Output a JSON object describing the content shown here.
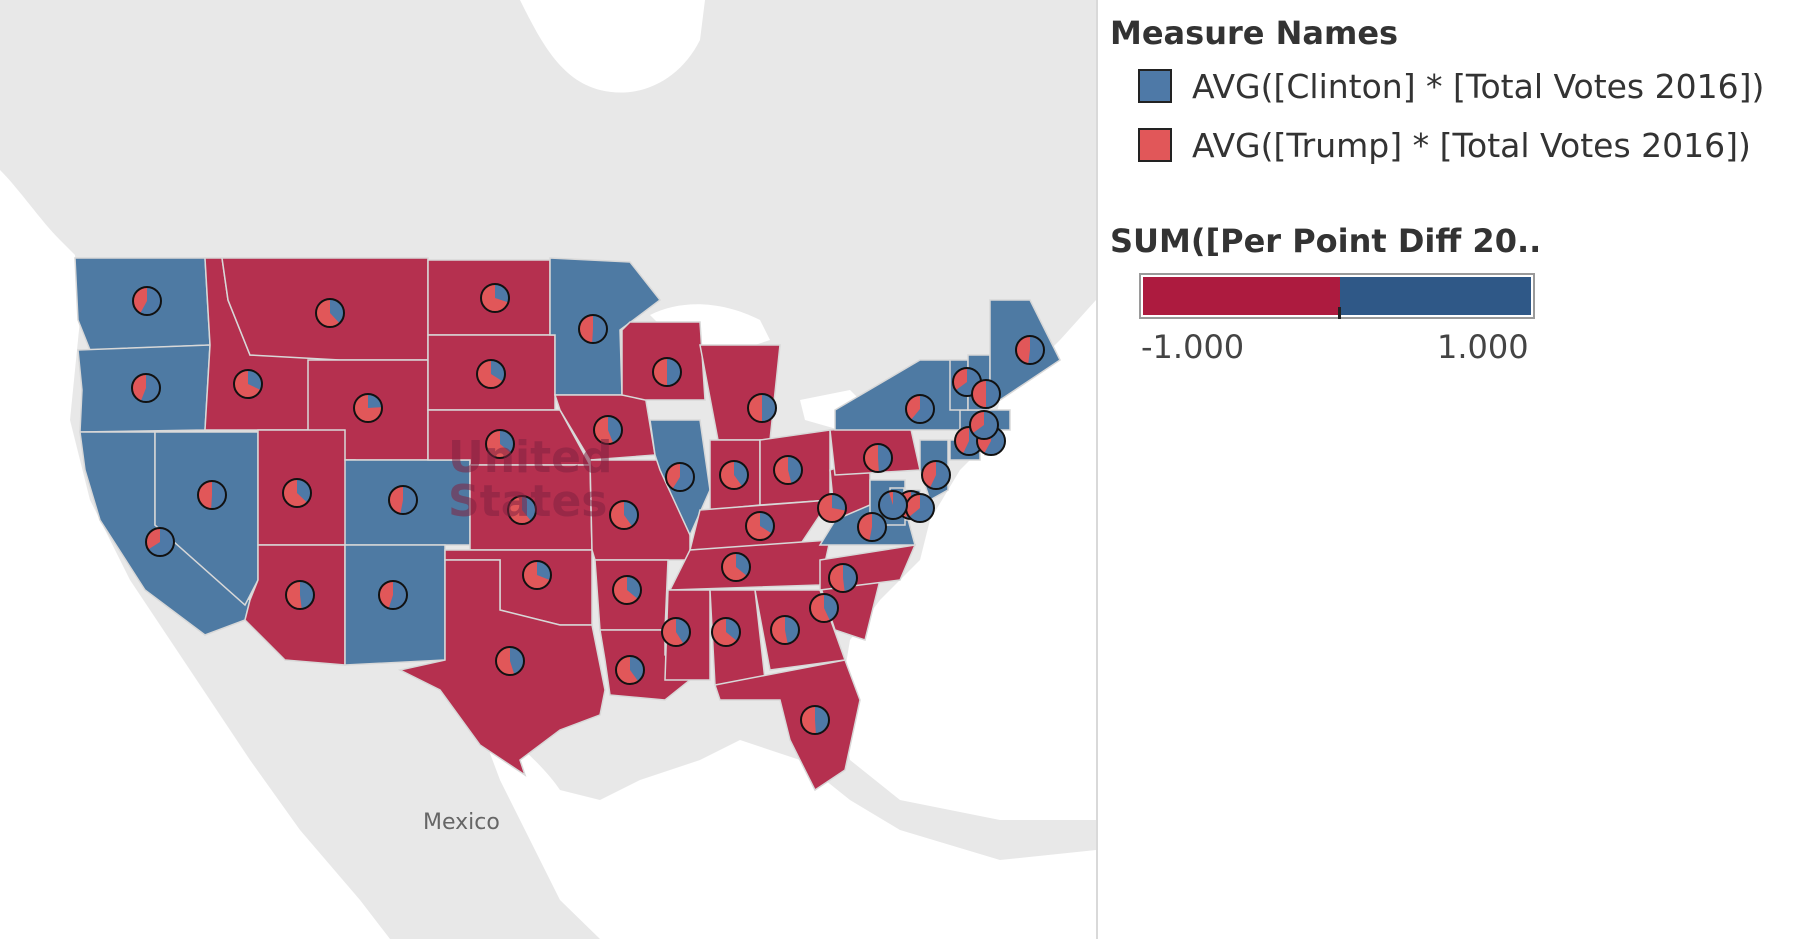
{
  "colors": {
    "clinton": "#4e79a7",
    "trump": "#e15759",
    "state_dem": "#4e7aa3",
    "state_rep": "#b5304f",
    "ramp_neg": "#ad1b3f",
    "ramp_pos": "#2f5887",
    "land": "#e8e8e8",
    "water": "#ffffff"
  },
  "map": {
    "country_label": "United States",
    "country_label_line1": "United",
    "country_label_line2": "States",
    "neighbor_label": "Mexico"
  },
  "legend": {
    "measure_title": "Measure Names",
    "items": [
      {
        "label": "AVG([Clinton] * [Total Votes 2016])",
        "color_key": "clinton"
      },
      {
        "label": "AVG([Trump] * [Total Votes 2016])",
        "color_key": "trump"
      }
    ],
    "color_title": "SUM([Per Point Diff 20..",
    "ramp_min": "-1.000",
    "ramp_max": "1.000"
  },
  "states": [
    {
      "code": "WA",
      "winner": "D",
      "clinton_share": 0.58
    },
    {
      "code": "OR",
      "winner": "D",
      "clinton_share": 0.56
    },
    {
      "code": "CA",
      "winner": "D",
      "clinton_share": 0.66
    },
    {
      "code": "NV",
      "winner": "D",
      "clinton_share": 0.51
    },
    {
      "code": "ID",
      "winner": "R",
      "clinton_share": 0.32
    },
    {
      "code": "MT",
      "winner": "R",
      "clinton_share": 0.38
    },
    {
      "code": "WY",
      "winner": "R",
      "clinton_share": 0.24
    },
    {
      "code": "UT",
      "winner": "R",
      "clinton_share": 0.37
    },
    {
      "code": "AZ",
      "winner": "R",
      "clinton_share": 0.48
    },
    {
      "code": "CO",
      "winner": "D",
      "clinton_share": 0.53
    },
    {
      "code": "NM",
      "winner": "D",
      "clinton_share": 0.55
    },
    {
      "code": "ND",
      "winner": "R",
      "clinton_share": 0.3
    },
    {
      "code": "SD",
      "winner": "R",
      "clinton_share": 0.34
    },
    {
      "code": "NE",
      "winner": "R",
      "clinton_share": 0.36
    },
    {
      "code": "KS",
      "winner": "R",
      "clinton_share": 0.39
    },
    {
      "code": "OK",
      "winner": "R",
      "clinton_share": 0.31
    },
    {
      "code": "TX",
      "winner": "R",
      "clinton_share": 0.45
    },
    {
      "code": "MN",
      "winner": "D",
      "clinton_share": 0.51
    },
    {
      "code": "IA",
      "winner": "R",
      "clinton_share": 0.44
    },
    {
      "code": "MO",
      "winner": "R",
      "clinton_share": 0.4
    },
    {
      "code": "AR",
      "winner": "R",
      "clinton_share": 0.36
    },
    {
      "code": "LA",
      "winner": "R",
      "clinton_share": 0.4
    },
    {
      "code": "WI",
      "winner": "R",
      "clinton_share": 0.5
    },
    {
      "code": "IL",
      "winner": "D",
      "clinton_share": 0.59
    },
    {
      "code": "MI",
      "winner": "R",
      "clinton_share": 0.5
    },
    {
      "code": "IN",
      "winner": "R",
      "clinton_share": 0.4
    },
    {
      "code": "OH",
      "winner": "R",
      "clinton_share": 0.46
    },
    {
      "code": "KY",
      "winner": "R",
      "clinton_share": 0.34
    },
    {
      "code": "TN",
      "winner": "R",
      "clinton_share": 0.36
    },
    {
      "code": "MS",
      "winner": "R",
      "clinton_share": 0.41
    },
    {
      "code": "AL",
      "winner": "R",
      "clinton_share": 0.36
    },
    {
      "code": "GA",
      "winner": "R",
      "clinton_share": 0.47
    },
    {
      "code": "FL",
      "winner": "R",
      "clinton_share": 0.49
    },
    {
      "code": "SC",
      "winner": "R",
      "clinton_share": 0.43
    },
    {
      "code": "NC",
      "winner": "R",
      "clinton_share": 0.48
    },
    {
      "code": "VA",
      "winner": "D",
      "clinton_share": 0.53
    },
    {
      "code": "WV",
      "winner": "R",
      "clinton_share": 0.28
    },
    {
      "code": "PA",
      "winner": "R",
      "clinton_share": 0.49
    },
    {
      "code": "NY",
      "winner": "D",
      "clinton_share": 0.61
    },
    {
      "code": "NJ",
      "winner": "D",
      "clinton_share": 0.57
    },
    {
      "code": "DE",
      "winner": "D",
      "clinton_share": 0.56
    },
    {
      "code": "MD",
      "winner": "D",
      "clinton_share": 0.64
    },
    {
      "code": "DC",
      "winner": "D",
      "clinton_share": 0.95
    },
    {
      "code": "CT",
      "winner": "D",
      "clinton_share": 0.57
    },
    {
      "code": "RI",
      "winner": "D",
      "clinton_share": 0.58
    },
    {
      "code": "MA",
      "winner": "D",
      "clinton_share": 0.65
    },
    {
      "code": "VT",
      "winner": "D",
      "clinton_share": 0.65
    },
    {
      "code": "NH",
      "winner": "D",
      "clinton_share": 0.5
    },
    {
      "code": "ME",
      "winner": "D",
      "clinton_share": 0.52
    }
  ]
}
